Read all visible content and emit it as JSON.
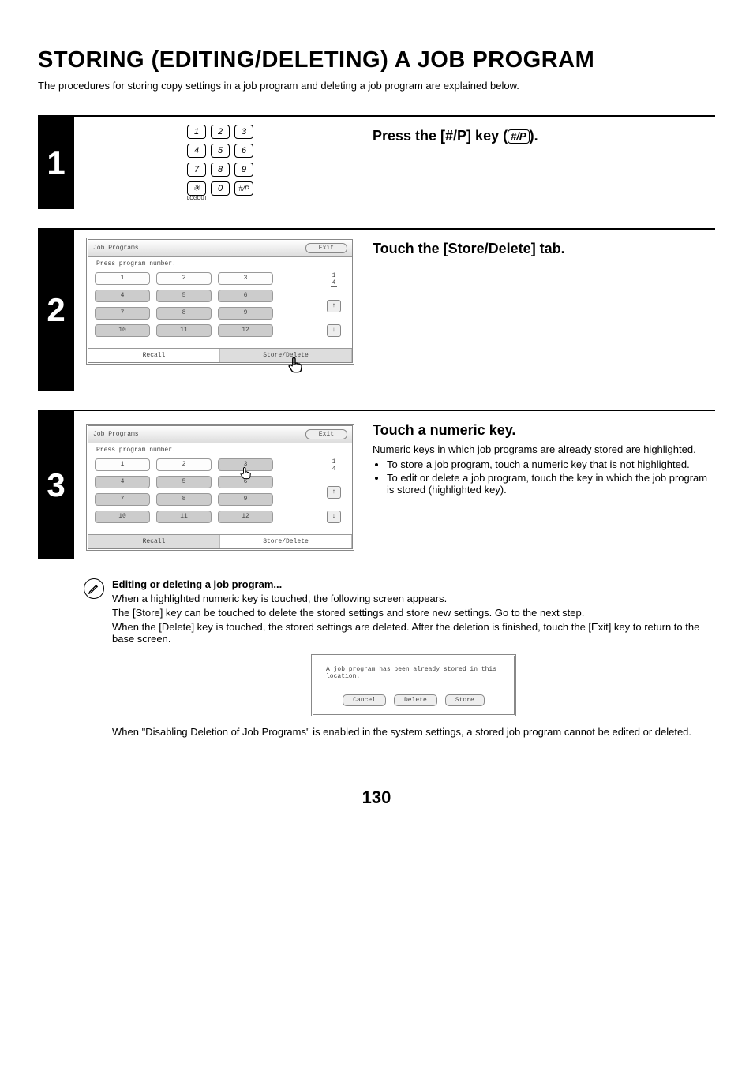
{
  "heading": "STORING (EDITING/DELETING) A JOB PROGRAM",
  "intro": "The procedures for storing copy settings in a job program and deleting a job program are explained below.",
  "keypad": {
    "keys": [
      "1",
      "2",
      "3",
      "4",
      "5",
      "6",
      "7",
      "8",
      "9",
      "✳",
      "0",
      "#/P"
    ],
    "logout_label": "LOGOUT"
  },
  "step1": {
    "num": "1",
    "title_prefix": "Press the [#/P] key (",
    "title_key": "#/P",
    "title_suffix": ")."
  },
  "step2": {
    "num": "2",
    "title": "Touch the [Store/Delete] tab.",
    "lcd": {
      "title": "Job Programs",
      "exit": "Exit",
      "instr": "Press program number.",
      "buttons": [
        "1",
        "2",
        "3",
        "4",
        "5",
        "6",
        "7",
        "8",
        "9",
        "10",
        "11",
        "12"
      ],
      "highlighted": [
        0,
        1,
        2
      ],
      "page": "1\n4",
      "up": "↑",
      "down": "↓",
      "tab_recall": "Recall",
      "tab_store": "Store/Delete"
    }
  },
  "step3": {
    "num": "3",
    "title": "Touch a numeric key.",
    "desc": "Numeric keys in which job programs are already stored are highlighted.",
    "bullets": [
      "To store a job program, touch a numeric key that is not highlighted.",
      "To edit or delete a job program, touch the key in which the job program is stored (highlighted key)."
    ],
    "lcd": {
      "title": "Job Programs",
      "exit": "Exit",
      "instr": "Press program number.",
      "buttons": [
        "1",
        "2",
        "3",
        "4",
        "5",
        "6",
        "7",
        "8",
        "9",
        "10",
        "11",
        "12"
      ],
      "highlighted": [
        0,
        1
      ],
      "page": "1\n4",
      "up": "↑",
      "down": "↓",
      "tab_recall": "Recall",
      "tab_store": "Store/Delete"
    },
    "note": {
      "heading": "Editing or deleting a job program...",
      "lines": [
        "When a highlighted numeric key is touched, the following screen appears.",
        "The [Store] key can be touched to delete the stored settings and store new settings. Go to the next step.",
        "When the [Delete] key is touched, the stored settings are deleted. After the deletion is finished, touch the [Exit] key to return to the base screen."
      ],
      "popup": {
        "msg": "A job program has been already stored in this location.",
        "cancel": "Cancel",
        "delete": "Delete",
        "store": "Store"
      },
      "final": "When \"Disabling Deletion of Job Programs\" is enabled in the system settings, a stored job program cannot be edited or deleted."
    }
  },
  "page_number": "130"
}
